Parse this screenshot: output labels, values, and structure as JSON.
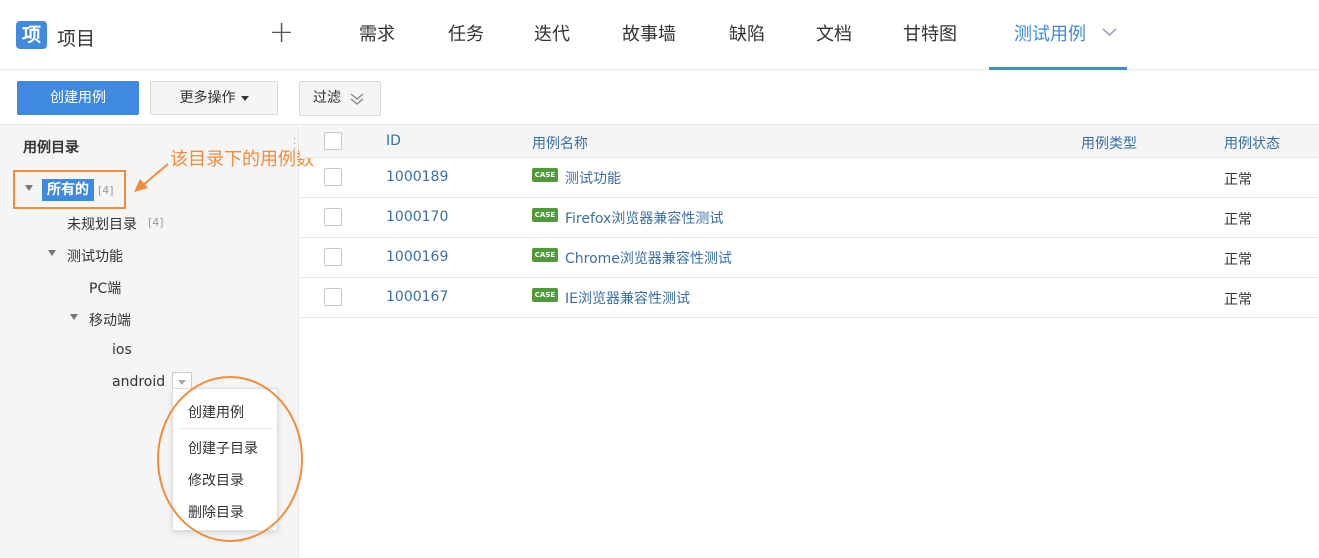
{
  "header": {
    "logo_text": "项",
    "app_title": "项目",
    "plus_label": "+",
    "tabs": [
      {
        "label": "需求"
      },
      {
        "label": "任务"
      },
      {
        "label": "迭代"
      },
      {
        "label": "故事墙"
      },
      {
        "label": "缺陷"
      },
      {
        "label": "文档"
      },
      {
        "label": "甘特图"
      },
      {
        "label": "测试用例"
      }
    ],
    "accent_color": "#3f8ae0"
  },
  "toolbar": {
    "create_label": "创建用例",
    "more_label": "更多操作",
    "filter_label": "过滤"
  },
  "sidebar": {
    "title": "用例目录",
    "tree": {
      "all": {
        "label": "所有的",
        "count": "[4]"
      },
      "unplanned": {
        "label": "未规划目录",
        "count": "[4]"
      },
      "test_func": {
        "label": "测试功能"
      },
      "pc": {
        "label": "PC端"
      },
      "mobile": {
        "label": "移动端"
      },
      "ios": {
        "label": "ios"
      },
      "android": {
        "label": "android"
      }
    },
    "annotation": "该目录下的用例数"
  },
  "context_menu": {
    "items": [
      {
        "label": "创建用例"
      },
      {
        "label": "创建子目录"
      },
      {
        "label": "修改目录"
      },
      {
        "label": "删除目录"
      }
    ]
  },
  "table": {
    "columns": {
      "id": "ID",
      "name": "用例名称",
      "type": "用例类型",
      "status": "用例状态"
    },
    "badge_label": "CASE",
    "rows": [
      {
        "id": "1000189",
        "name": "测试功能",
        "type": "",
        "status": "正常"
      },
      {
        "id": "1000170",
        "name": "Firefox浏览器兼容性测试",
        "type": "",
        "status": "正常"
      },
      {
        "id": "1000169",
        "name": "Chrome浏览器兼容性测试",
        "type": "",
        "status": "正常"
      },
      {
        "id": "1000167",
        "name": "IE浏览器兼容性测试",
        "type": "",
        "status": "正常"
      }
    ]
  }
}
